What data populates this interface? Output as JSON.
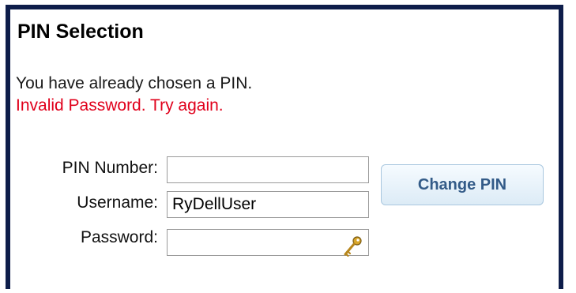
{
  "title": "PIN Selection",
  "messages": {
    "info": "You have already chosen a PIN.",
    "error": "Invalid Password. Try again."
  },
  "form": {
    "pin": {
      "label": "PIN Number:",
      "value": ""
    },
    "username": {
      "label": "Username:",
      "value": "RyDellUser"
    },
    "password": {
      "label": "Password:",
      "value": "",
      "icon": "key-icon"
    }
  },
  "button": {
    "label": "Change PIN"
  },
  "colors": {
    "border": "#0e1d4a",
    "error": "#e0001b",
    "button_text": "#335b88"
  }
}
